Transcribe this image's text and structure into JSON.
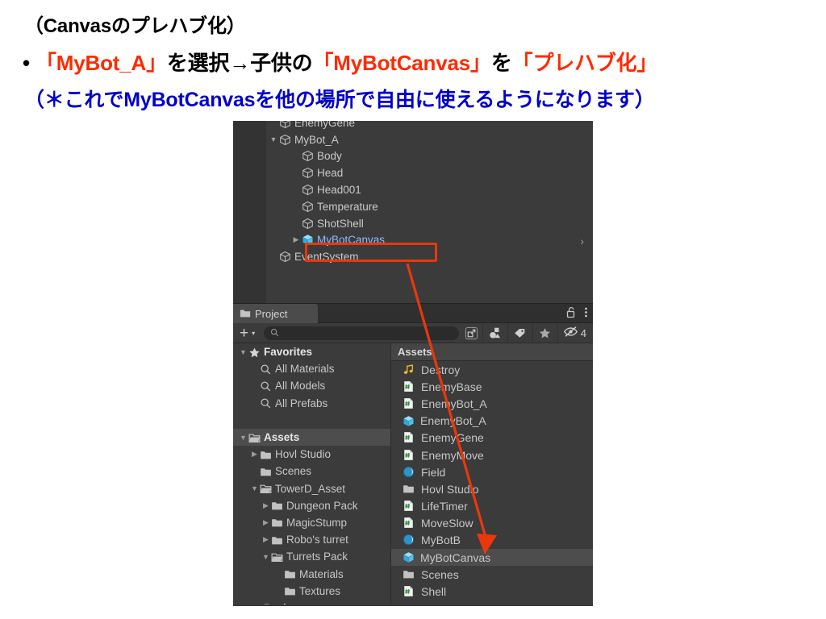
{
  "slide": {
    "line1": "（Canvasのプレハブ化）",
    "line2": {
      "bullet": "•",
      "seg1": "「MyBot_A」",
      "seg2": "を選択→子供の",
      "seg3": "「MyBotCanvas」",
      "seg4": "を",
      "seg5": "「プレハブ化」"
    },
    "line3": "（＊これでMyBotCanvasを他の場所で自由に使えるようになります）",
    "colors": {
      "red": "#ff2a00",
      "blue": "#0000cc",
      "black": "#000000"
    }
  },
  "hierarchy": {
    "items": [
      {
        "label": "EnemyGene",
        "indent": 1,
        "arrow": "none",
        "icon": "gameobject-cube-icon",
        "selected": false
      },
      {
        "label": "MyBot_A",
        "indent": 1,
        "arrow": "expanded",
        "icon": "gameobject-cube-icon",
        "selected": false
      },
      {
        "label": "Body",
        "indent": 2,
        "arrow": "none",
        "icon": "gameobject-cube-icon",
        "selected": false
      },
      {
        "label": "Head",
        "indent": 2,
        "arrow": "none",
        "icon": "gameobject-cube-icon",
        "selected": false
      },
      {
        "label": "Head001",
        "indent": 2,
        "arrow": "none",
        "icon": "gameobject-cube-icon",
        "selected": false
      },
      {
        "label": "Temperature",
        "indent": 2,
        "arrow": "none",
        "icon": "gameobject-cube-icon",
        "selected": false
      },
      {
        "label": "ShotShell",
        "indent": 2,
        "arrow": "none",
        "icon": "gameobject-cube-icon",
        "selected": false
      },
      {
        "label": "MyBotCanvas",
        "indent": 2,
        "arrow": "collapsed",
        "icon": "prefab-cube-icon",
        "selected": true
      },
      {
        "label": "EventSystem",
        "indent": 1,
        "arrow": "none",
        "icon": "gameobject-cube-icon",
        "selected": false
      }
    ],
    "row_chevron": "›"
  },
  "project": {
    "tab": {
      "label": "Project",
      "icon": "folder-icon"
    },
    "lock_icon": "unlocked-padlock-icon",
    "menu_icon": "kebab-menu-icon",
    "toolbar": {
      "add_label": "+",
      "add_caret": "▾",
      "search_value": "",
      "search_placeholder": "",
      "buttons": [
        {
          "name": "open-in-new-window-icon"
        },
        {
          "name": "filter-by-type-icon"
        },
        {
          "name": "filter-by-label-icon"
        },
        {
          "name": "filter-favorites-star-icon"
        }
      ],
      "hidden_toggle": {
        "icon": "eye-slash-icon",
        "count": "4"
      }
    },
    "tree": [
      {
        "label": "Favorites",
        "indent": 0,
        "arrow": "expanded",
        "icon": "star-icon",
        "selected": false,
        "bold": true
      },
      {
        "label": "All Materials",
        "indent": 1,
        "arrow": "none",
        "icon": "search-icon",
        "selected": false,
        "bold": false
      },
      {
        "label": "All Models",
        "indent": 1,
        "arrow": "none",
        "icon": "search-icon",
        "selected": false,
        "bold": false
      },
      {
        "label": "All Prefabs",
        "indent": 1,
        "arrow": "none",
        "icon": "search-icon",
        "selected": false,
        "bold": false
      },
      {
        "label": "",
        "indent": 0,
        "arrow": "none",
        "icon": "spacer",
        "selected": false,
        "bold": false
      },
      {
        "label": "Assets",
        "indent": 0,
        "arrow": "expanded",
        "icon": "folder-open-icon",
        "selected": true,
        "bold": true
      },
      {
        "label": "Hovl Studio",
        "indent": 1,
        "arrow": "collapsed",
        "icon": "folder-icon",
        "selected": false,
        "bold": false
      },
      {
        "label": "Scenes",
        "indent": 1,
        "arrow": "none",
        "icon": "folder-icon",
        "selected": false,
        "bold": false
      },
      {
        "label": "TowerD_Asset",
        "indent": 1,
        "arrow": "expanded",
        "icon": "folder-open-icon",
        "selected": false,
        "bold": false
      },
      {
        "label": "Dungeon Pack",
        "indent": 2,
        "arrow": "collapsed",
        "icon": "folder-icon",
        "selected": false,
        "bold": false
      },
      {
        "label": "MagicStump",
        "indent": 2,
        "arrow": "collapsed",
        "icon": "folder-icon",
        "selected": false,
        "bold": false
      },
      {
        "label": "Robo's turret",
        "indent": 2,
        "arrow": "collapsed",
        "icon": "folder-icon",
        "selected": false,
        "bold": false
      },
      {
        "label": "Turrets Pack",
        "indent": 2,
        "arrow": "expanded",
        "icon": "folder-open-icon",
        "selected": false,
        "bold": false
      },
      {
        "label": "Materials",
        "indent": 3,
        "arrow": "none",
        "icon": "folder-icon",
        "selected": false,
        "bold": false
      },
      {
        "label": "Textures",
        "indent": 3,
        "arrow": "none",
        "icon": "folder-icon",
        "selected": false,
        "bold": false
      },
      {
        "label": "Packages",
        "indent": 0,
        "arrow": "collapsed",
        "icon": "folder-icon",
        "selected": false,
        "bold": true
      }
    ],
    "breadcrumb": "Assets",
    "assets": [
      {
        "label": "Destroy",
        "icon": "audio-clip-icon",
        "selected": false
      },
      {
        "label": "EnemyBase",
        "icon": "cs-script-icon",
        "selected": false
      },
      {
        "label": "EnemyBot_A",
        "icon": "cs-script-icon",
        "selected": false
      },
      {
        "label": "EnemyBot_A",
        "icon": "prefab-cube-icon",
        "selected": false
      },
      {
        "label": "EnemyGene",
        "icon": "cs-script-icon",
        "selected": false
      },
      {
        "label": "EnemyMove",
        "icon": "cs-script-icon",
        "selected": false
      },
      {
        "label": "Field",
        "icon": "material-icon",
        "selected": false
      },
      {
        "label": "Hovl Studio",
        "icon": "folder-icon",
        "selected": false
      },
      {
        "label": "LifeTimer",
        "icon": "cs-script-icon",
        "selected": false
      },
      {
        "label": "MoveSlow",
        "icon": "cs-script-icon",
        "selected": false
      },
      {
        "label": "MyBotB",
        "icon": "material-icon",
        "selected": false
      },
      {
        "label": "MyBotCanvas",
        "icon": "prefab-cube-icon",
        "selected": true
      },
      {
        "label": "Scenes",
        "icon": "folder-icon",
        "selected": false
      },
      {
        "label": "Shell",
        "icon": "cs-script-icon",
        "selected": false
      }
    ]
  },
  "annotation": {
    "highlight_color": "#e8380d",
    "arrow_color": "#e8380d",
    "highlight_target": "MyBotCanvas",
    "arrow_target": "MyBotCanvas"
  }
}
